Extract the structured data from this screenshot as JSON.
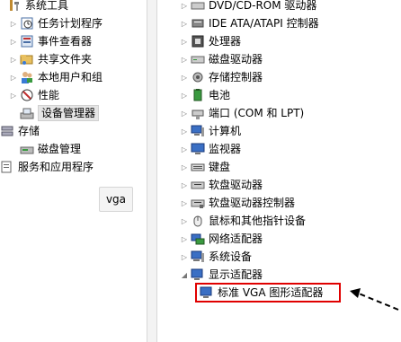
{
  "left_tree": {
    "items": [
      {
        "label": "系统工具",
        "icon": "system-tools-icon",
        "expander": "open"
      },
      {
        "label": "任务计划程序",
        "icon": "task-scheduler-icon",
        "expander": "closed"
      },
      {
        "label": "事件查看器",
        "icon": "event-viewer-icon",
        "expander": "closed"
      },
      {
        "label": "共享文件夹",
        "icon": "shared-folder-icon",
        "expander": "closed"
      },
      {
        "label": "本地用户和组",
        "icon": "users-icon",
        "expander": "closed"
      },
      {
        "label": "性能",
        "icon": "performance-icon",
        "expander": "closed"
      },
      {
        "label": "设备管理器",
        "icon": "device-manager-icon",
        "expander": "none"
      },
      {
        "label": "存储",
        "icon": "storage-icon",
        "expander": "open"
      },
      {
        "label": "磁盘管理",
        "icon": "disk-management-icon",
        "expander": "none"
      },
      {
        "label": "服务和应用程序",
        "icon": "services-icon",
        "expander": "closed"
      }
    ],
    "action_button": "vga"
  },
  "device_tree": {
    "items": [
      {
        "label": "DVD/CD-ROM 驱动器",
        "icon": "dvd-drive-icon"
      },
      {
        "label": "IDE ATA/ATAPI 控制器",
        "icon": "ide-controller-icon"
      },
      {
        "label": "处理器",
        "icon": "processor-icon"
      },
      {
        "label": "磁盘驱动器",
        "icon": "disk-drive-icon"
      },
      {
        "label": "存储控制器",
        "icon": "storage-controller-icon"
      },
      {
        "label": "电池",
        "icon": "battery-icon"
      },
      {
        "label": "端口 (COM 和 LPT)",
        "icon": "port-icon"
      },
      {
        "label": "计算机",
        "icon": "computer-icon"
      },
      {
        "label": "监视器",
        "icon": "monitor-icon"
      },
      {
        "label": "键盘",
        "icon": "keyboard-icon"
      },
      {
        "label": "软盘驱动器",
        "icon": "floppy-drive-icon"
      },
      {
        "label": "软盘驱动器控制器",
        "icon": "floppy-controller-icon"
      },
      {
        "label": "鼠标和其他指针设备",
        "icon": "mouse-icon"
      },
      {
        "label": "网络适配器",
        "icon": "network-adapter-icon"
      },
      {
        "label": "系统设备",
        "icon": "system-devices-icon"
      },
      {
        "label": "显示适配器",
        "icon": "display-adapter-icon",
        "expanded": true
      }
    ],
    "child": {
      "label": "标准 VGA 图形适配器",
      "icon": "vga-adapter-icon"
    }
  },
  "colors": {
    "highlight": "#e00000",
    "arrow": "#000000"
  }
}
